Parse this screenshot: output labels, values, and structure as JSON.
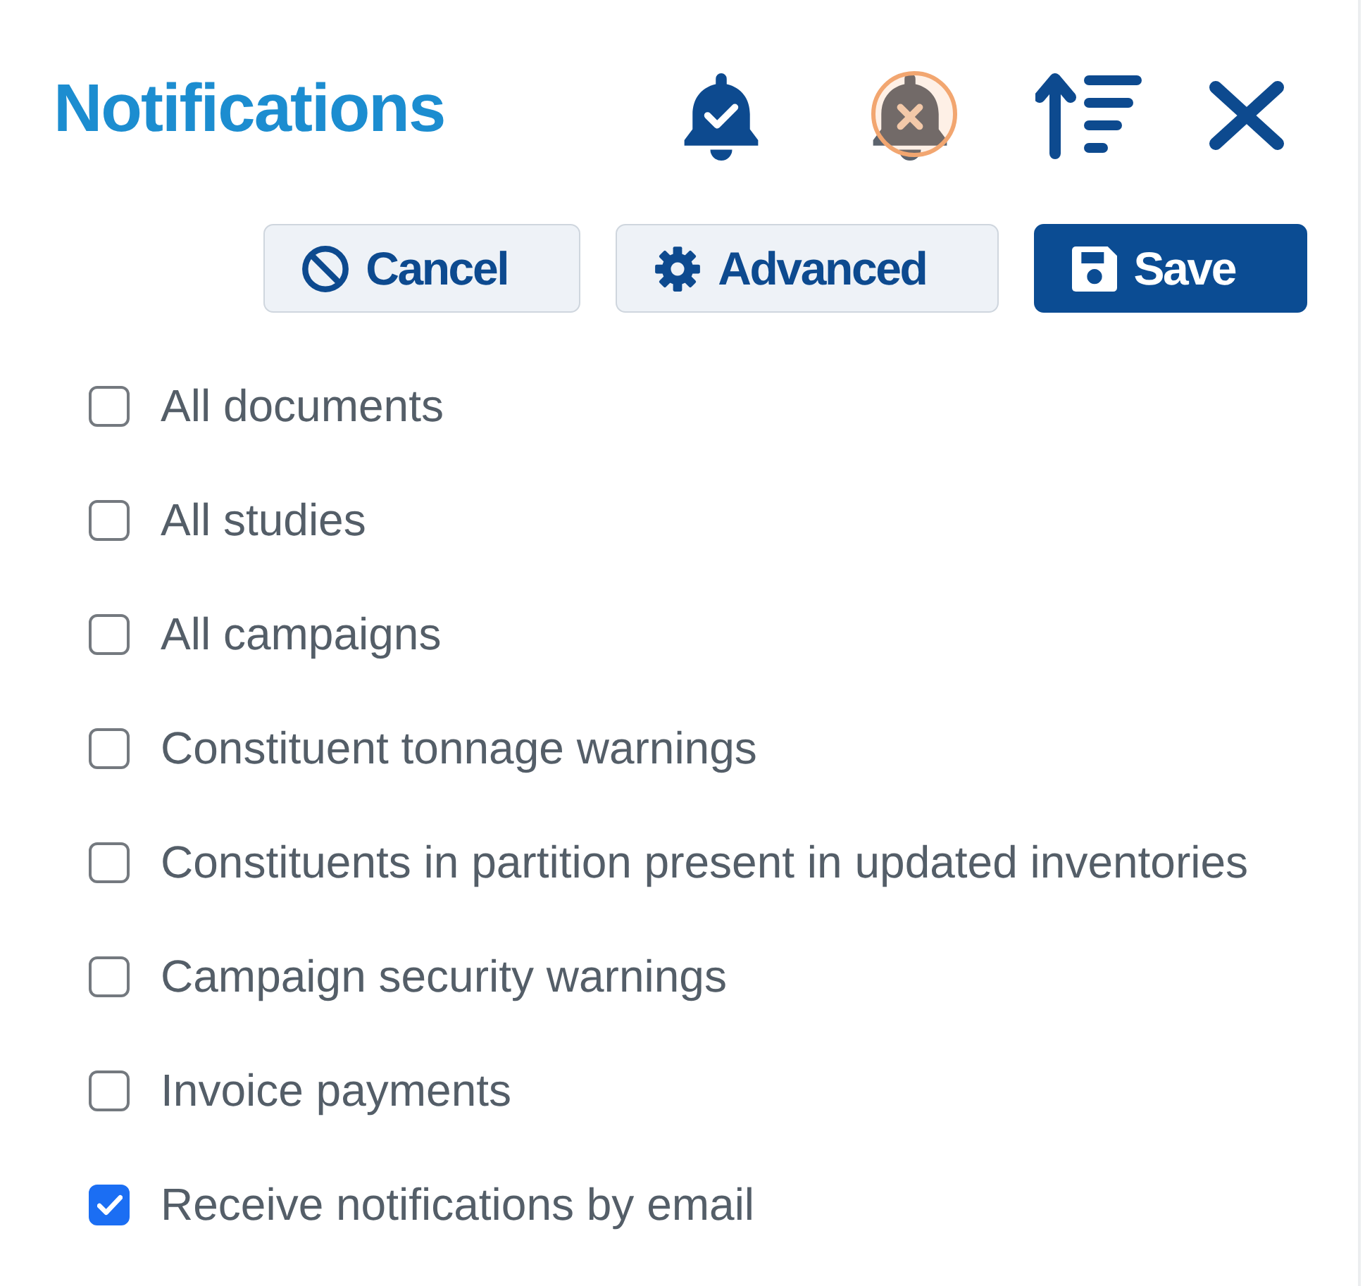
{
  "panel": {
    "title": "Notifications"
  },
  "buttons": [
    {
      "label": "Cancel",
      "kind": "cancel"
    },
    {
      "label": "Advanced",
      "kind": "advanced"
    },
    {
      "label": "Save",
      "kind": "save"
    }
  ],
  "options": [
    {
      "label": "All documents",
      "checked": false
    },
    {
      "label": "All studies",
      "checked": false
    },
    {
      "label": "All campaigns",
      "checked": false
    },
    {
      "label": "Constituent tonnage warnings",
      "checked": false
    },
    {
      "label": "Constituents in partition present in updated inventories",
      "checked": false
    },
    {
      "label": "Campaign security warnings",
      "checked": false
    },
    {
      "label": "Invoice payments",
      "checked": false
    },
    {
      "label": "Receive notifications by email",
      "checked": true
    }
  ]
}
